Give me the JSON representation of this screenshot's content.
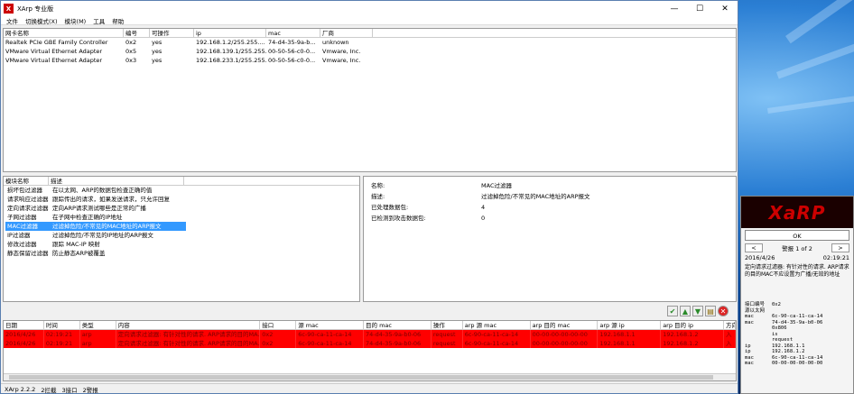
{
  "window": {
    "title": "XArp 专业版",
    "icon_text": "X",
    "controls": [
      "—",
      "☐",
      "✕"
    ]
  },
  "menu": [
    "文件",
    "切换模式(X)",
    "模块(M)",
    "工具",
    "帮助"
  ],
  "adapters": {
    "headers": [
      "网卡名称",
      "编号",
      "可操作",
      "ip",
      "mac",
      "厂商"
    ],
    "rows": [
      [
        "Realtek PCIe GBE Family Controller",
        "0x2",
        "yes",
        "192.168.1.2/255.255....",
        "74-d4-35-9a-b...",
        "unknown"
      ],
      [
        "VMware Virtual Ethernet Adapter",
        "0x5",
        "yes",
        "192.168.139.1/255.255...",
        "00-50-56-c0-0...",
        "Vmware, Inc."
      ],
      [
        "VMware Virtual Ethernet Adapter",
        "0x3",
        "yes",
        "192.168.233.1/255.255...",
        "00-50-56-c0-0...",
        "Vmware, Inc."
      ]
    ]
  },
  "modules": {
    "headers": [
      "模块名称",
      "描述"
    ],
    "rows": [
      [
        "损坏包过滤器",
        "在以太网、ARP的数据包检查正确的值"
      ],
      [
        "请求响应过滤器",
        "跟踪传出的请求，如果发送请求，只允许回复"
      ],
      [
        "定向请求过滤器",
        "定向ARP请求测试哪些是正常的广播"
      ],
      [
        "子网过滤器",
        "在子网中检查正确的IP地址"
      ],
      [
        "MAC过滤器",
        "过滤掉危险/不常见的MAC地址的ARP报文"
      ],
      [
        "IP过滤器",
        "过滤掉危险/不常见的IP地址的ARP报文"
      ],
      [
        "修改过滤器",
        "跟踪 MAC-IP 映射"
      ],
      [
        "静态保留过滤器",
        "防止静态ARP被覆盖"
      ]
    ],
    "selected_index": 4
  },
  "details": [
    {
      "label": "名称:",
      "value": "MAC过滤器"
    },
    {
      "label": "描述:",
      "value": "过滤掉危险/不常见的MAC地址的ARP报文"
    },
    {
      "label": "已处理数据包:",
      "value": "4"
    },
    {
      "label": "已检测到攻击数据包:",
      "value": "0"
    }
  ],
  "toolbar_icons": [
    "check-icon",
    "arrow-up-icon",
    "arrow-down-icon",
    "document-icon",
    "stop-icon"
  ],
  "log": {
    "headers": [
      "日期",
      "时间",
      "类型",
      "内容",
      "接口",
      "源 mac",
      "目的 mac",
      "操作",
      "arp 源 mac",
      "arp 目的 mac",
      "arp 源 ip",
      "arp 目的 ip",
      "方向"
    ],
    "rows": [
      [
        "2016/4/26",
        "02:19:21",
        "arp",
        "定向请求过滤器: 有针对性的请求. ARP请求的目的MA...",
        "0x2",
        "6c-90-ca-11-ca-14",
        "74-d4-35-9a-b0-06",
        "request",
        "6c-90-ca-11-ca-14",
        "00-00-00-00-00-00",
        "192.168.1.1",
        "192.168.1.2",
        "入"
      ],
      [
        "2016/4/26",
        "02:19:21",
        "arp",
        "定向请求过滤器: 有针对性的请求. ARP请求的目的MA...",
        "0x2",
        "6c-90-ca-11-ca-14",
        "74-d4-35-9a-b0-06",
        "request",
        "6c-90-ca-11-ca-14",
        "00-00-00-00-00-00",
        "192.168.1.1",
        "192.168.1.2",
        "入"
      ]
    ],
    "row_color": "#ff0000"
  },
  "status": [
    "XArp 2.2.2",
    "2拦截",
    "3接口",
    "2警报"
  ],
  "popup": {
    "banner": "XaRP",
    "ok": "OK",
    "nav_prev": "<",
    "nav_label": "警报 1 of 2",
    "nav_next": ">",
    "date": "2016/4/26",
    "time": "02:19:21",
    "message": "定向请求过滤器: 有针对性的请求. ARP请求的目的MAC不应设置为广播/无效的地址",
    "dump": [
      [
        "接口编号",
        "0x2"
      ],
      [
        "源以太网",
        ""
      ],
      [
        "mac",
        "6c-90-ca-11-ca-14"
      ],
      [
        "mac",
        "74-d4-35-9a-b0-06"
      ],
      [
        "",
        "0x806"
      ],
      [
        "",
        ""
      ],
      [
        "",
        "is"
      ],
      [
        "",
        "request"
      ],
      [
        "ip",
        "192.168.1.1"
      ],
      [
        "ip",
        "192.168.1.2"
      ],
      [
        "mac",
        "6c-90-ca-11-ca-14"
      ],
      [
        "mac",
        "00-00-00-00-00-00"
      ]
    ]
  }
}
